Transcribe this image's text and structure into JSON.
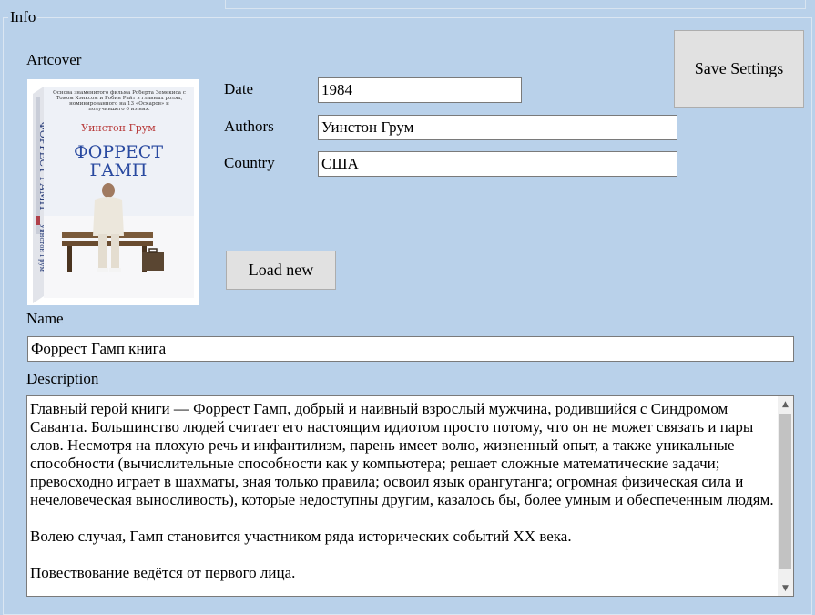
{
  "group": {
    "title": "Info"
  },
  "artcover": {
    "label": "Artcover",
    "image": {
      "author": "Уинстон Грум",
      "title_line1": "ФОРРЕСТ",
      "title_line2": "ГАМП",
      "spine_title": "ФОРРЕСТ ГАМП",
      "spine_author": "Уинстон Грум",
      "blurb": "Основа знаменитого фильма Роберта Земекиса с Томом Хэнксом и Робин Райт в главных ролях, номинированного на 13 «Оскаров» и получившего 6 из них."
    }
  },
  "buttons": {
    "save": "Save Settings",
    "load": "Load new"
  },
  "fields": {
    "date": {
      "label": "Date",
      "value": "1984"
    },
    "authors": {
      "label": "Authors",
      "value": "Уинстон Грум"
    },
    "country": {
      "label": "Country",
      "value": "США"
    },
    "name": {
      "label": "Name",
      "value": "Форрест Гамп книга"
    }
  },
  "description": {
    "label": "Description",
    "text": "Главный герой книги — Форрест Гамп, добрый и наивный взрослый мужчина, родившийся с Синдромом Саванта. Большинство людей считает его настоящим идиотом просто потому, что он не может связать и пары слов. Несмотря на плохую речь и инфантилизм, парень имеет волю, жизненный опыт, а также уникальные способности (вычислительные способности как у компьютера; решает сложные математические задачи; превосходно играет в шахматы, зная только правила; освоил язык орангутанга; огромная физическая сила и нечеловеческая выносливость), которые недоступны другим, казалось бы, более умным и обеспеченным людям.\n\nВолею случая, Гамп становится участником ряда исторических событий XX века.\n\nПовествование ведётся от первого лица."
  },
  "icons": {
    "scroll_up": "scroll-up-arrow-icon",
    "scroll_down": "scroll-down-arrow-icon"
  },
  "colors": {
    "background": "#b9d1ea",
    "button": "#e1e1e1",
    "field_border": "#7a7a7a"
  }
}
